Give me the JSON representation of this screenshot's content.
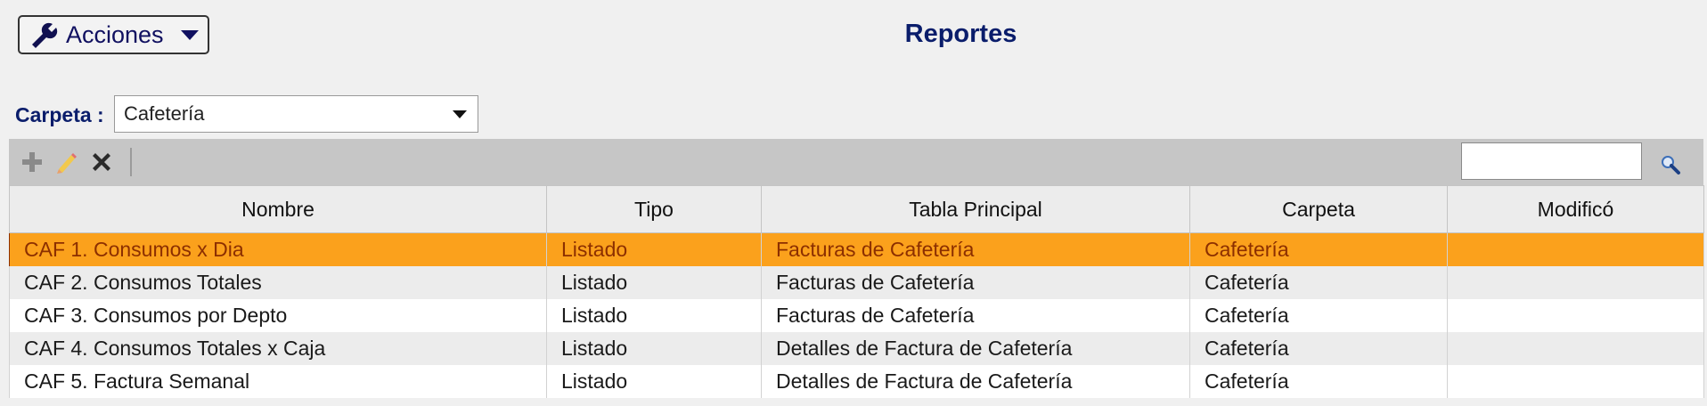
{
  "header": {
    "actions_label": "Acciones",
    "title": "Reportes"
  },
  "filter": {
    "folder_label": "Carpeta :",
    "folder_value": "Cafetería"
  },
  "toolbar": {
    "icons": [
      "add-icon",
      "edit-icon",
      "delete-icon",
      "search-icon"
    ],
    "search_value": ""
  },
  "table": {
    "columns": [
      "Nombre",
      "Tipo",
      "Tabla Principal",
      "Carpeta",
      "Modificó"
    ],
    "rows": [
      {
        "nombre": "CAF 1. Consumos x Dia",
        "tipo": "Listado",
        "tabla": "Facturas de Cafetería",
        "carpeta": "Cafetería",
        "modifico": ""
      },
      {
        "nombre": "CAF 2. Consumos Totales",
        "tipo": "Listado",
        "tabla": "Facturas de Cafetería",
        "carpeta": "Cafetería",
        "modifico": ""
      },
      {
        "nombre": "CAF 3. Consumos por Depto",
        "tipo": "Listado",
        "tabla": "Facturas de Cafetería",
        "carpeta": "Cafetería",
        "modifico": ""
      },
      {
        "nombre": "CAF 4. Consumos Totales x Caja",
        "tipo": "Listado",
        "tabla": "Detalles de Factura de Cafetería",
        "carpeta": "Cafetería",
        "modifico": ""
      },
      {
        "nombre": "CAF 5. Factura Semanal",
        "tipo": "Listado",
        "tabla": "Detalles de Factura de Cafetería",
        "carpeta": "Cafetería",
        "modifico": ""
      }
    ]
  },
  "colors": {
    "selected_row": "#fba11c",
    "title": "#0a1d6b"
  }
}
